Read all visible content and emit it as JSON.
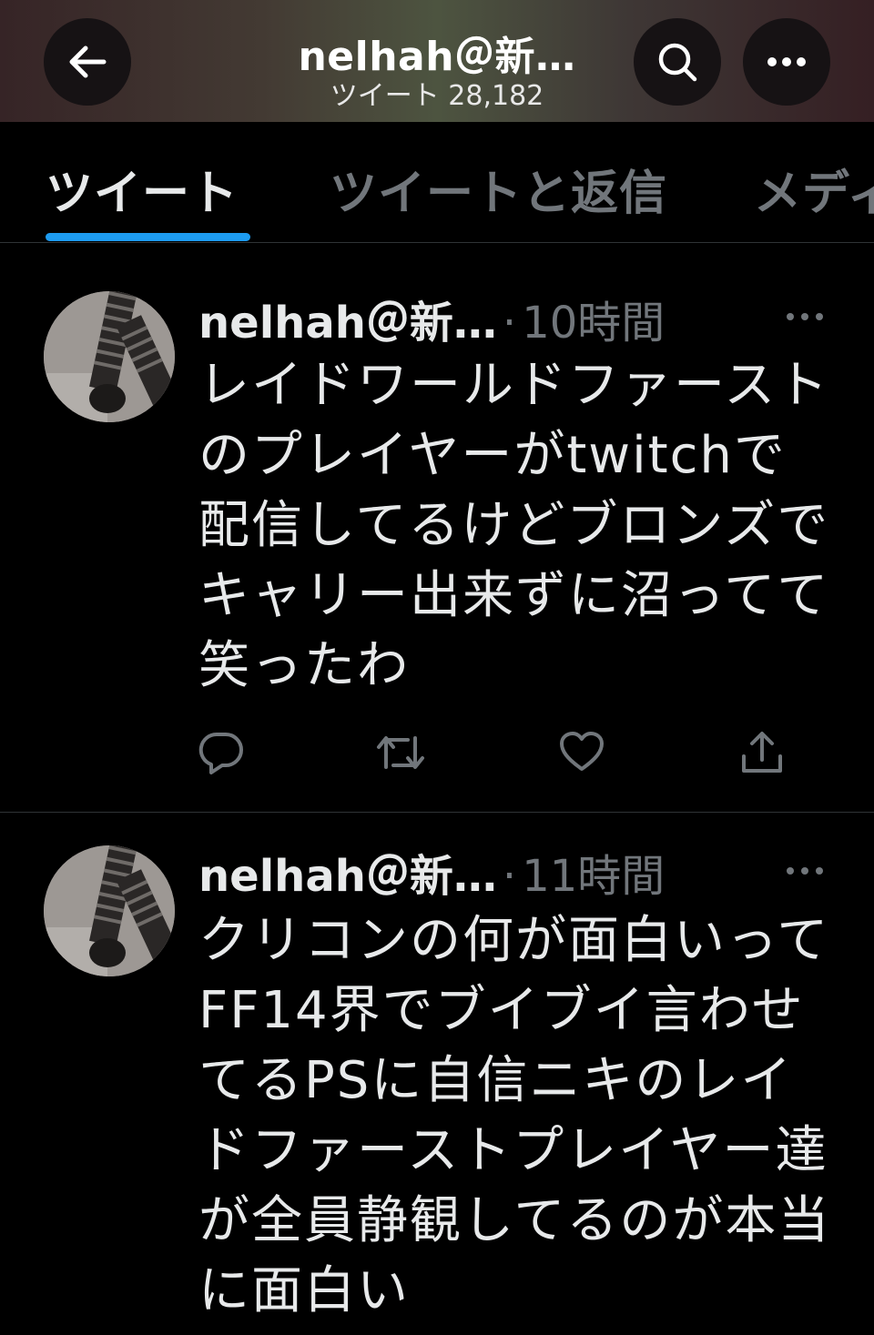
{
  "header": {
    "title": "nelhah＠新…",
    "subtitle": "ツイート 28,182",
    "icons": {
      "back": "back-arrow-icon",
      "search": "search-icon",
      "more": "more-icon"
    }
  },
  "tabs": [
    {
      "label": "ツイート",
      "active": true
    },
    {
      "label": "ツイートと返信",
      "active": false
    },
    {
      "label": "メディ",
      "active": false
    }
  ],
  "tweets": [
    {
      "author": "nelhah＠新…",
      "dot": "·",
      "time": "10時間",
      "text": "レイドワールドファーストのプレイヤーがtwitchで配信してるけどブロンズでキャリー出来ずに沼ってて笑ったわ",
      "actions": [
        "reply-icon",
        "retweet-icon",
        "like-icon",
        "share-icon"
      ]
    },
    {
      "author": "nelhah＠新…",
      "dot": "·",
      "time": "11時間",
      "text": "クリコンの何が面白いってFF14界でブイブイ言わせてるPSに自信ニキのレイドファーストプレイヤー達が全員静観してるのが本当に面白い"
    }
  ],
  "colors": {
    "accent": "#1d9bf0",
    "secondary_text": "#71767b",
    "divider": "#2f3336"
  }
}
